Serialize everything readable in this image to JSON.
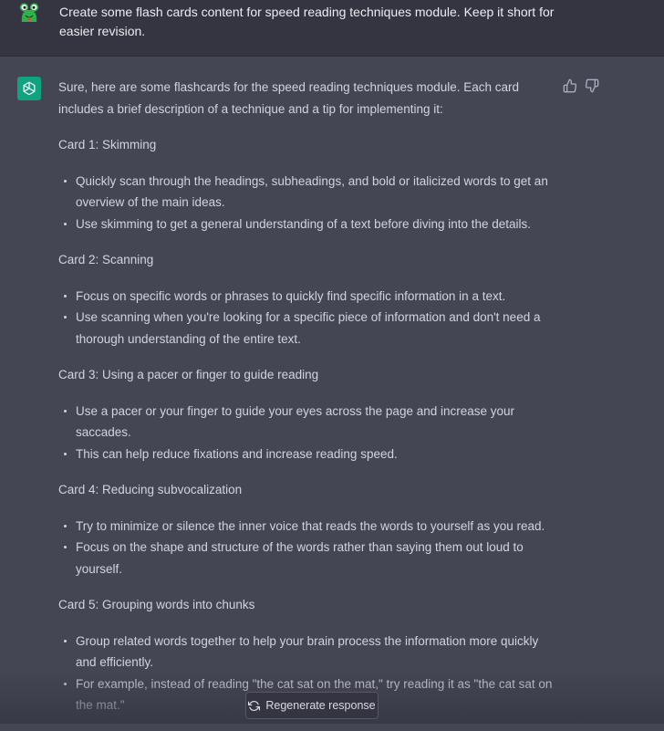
{
  "user_message": {
    "avatar_icon": "frog-avatar-icon",
    "text": "Create some flash cards content for speed reading techniques module. Keep it short for easier revision."
  },
  "assistant_message": {
    "avatar_icon": "openai-logo-icon",
    "intro": "Sure, here are some flashcards for the speed reading techniques module. Each card includes a brief description of a technique and a tip for implementing it:",
    "cards": [
      {
        "title": "Card 1: Skimming",
        "bullets": [
          "Quickly scan through the headings, subheadings, and bold or italicized words to get an overview of the main ideas.",
          "Use skimming to get a general understanding of a text before diving into the details."
        ]
      },
      {
        "title": "Card 2: Scanning",
        "bullets": [
          "Focus on specific words or phrases to quickly find specific information in a text.",
          "Use scanning when you're looking for a specific piece of information and don't need a thorough understanding of the entire text."
        ]
      },
      {
        "title": "Card 3: Using a pacer or finger to guide reading",
        "bullets": [
          "Use a pacer or your finger to guide your eyes across the page and increase your saccades.",
          "This can help reduce fixations and increase reading speed."
        ]
      },
      {
        "title": "Card 4: Reducing subvocalization",
        "bullets": [
          "Try to minimize or silence the inner voice that reads the words to yourself as you read.",
          "Focus on the shape and structure of the words rather than saying them out loud to yourself."
        ]
      },
      {
        "title": "Card 5: Grouping words into chunks",
        "bullets": [
          "Group related words together to help your brain process the information more quickly and efficiently.",
          "For example, instead of reading \"the cat sat on the mat,\" try reading it as \"the cat sat on the mat.\""
        ]
      }
    ],
    "feedback": {
      "thumbs_up_icon": "thumbs-up-icon",
      "thumbs_down_icon": "thumbs-down-icon"
    }
  },
  "regenerate_button": {
    "label": "Regenerate response",
    "icon": "refresh-icon"
  },
  "colors": {
    "user_bg": "#343541",
    "assistant_bg": "#444654",
    "text": "#d1d5db",
    "brand_green": "#10a37f"
  }
}
